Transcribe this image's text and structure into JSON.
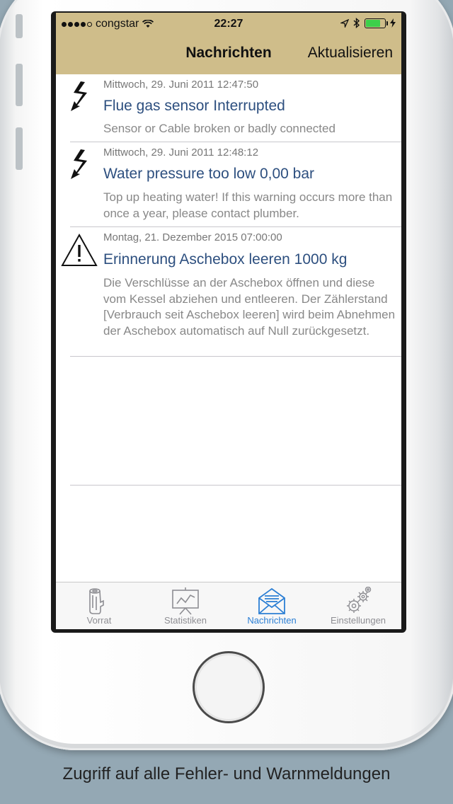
{
  "status_bar": {
    "carrier": "congstar",
    "time": "22:27"
  },
  "nav": {
    "title": "Nachrichten",
    "right_button": "Aktualisieren"
  },
  "messages": [
    {
      "icon": "lightning-icon",
      "date": "Mittwoch, 29. Juni 2011 12:47:50",
      "title": "Flue gas sensor Interrupted",
      "description": "Sensor or Cable broken or badly connected"
    },
    {
      "icon": "lightning-icon",
      "date": "Mittwoch, 29. Juni 2011 12:48:12",
      "title": "Water pressure too low 0,00 bar",
      "description": "Top up heating water! If this warning occurs more than once a year, please contact plumber."
    },
    {
      "icon": "warning-triangle-icon",
      "date": "Montag, 21. Dezember 2015 07:00:00",
      "title": "Erinnerung Aschebox leeren 1000 kg",
      "description": "Die Verschlüsse an der Aschebox öffnen und diese vom Kessel abziehen und entleeren. Der Zählerstand [Verbrauch seit Aschebox leeren] wird beim Abnehmen der Aschebox automatisch auf Null zurückgesetzt."
    }
  ],
  "tabs": [
    {
      "label": "Vorrat",
      "icon": "wood-log-icon",
      "active": false
    },
    {
      "label": "Statistiken",
      "icon": "chart-board-icon",
      "active": false
    },
    {
      "label": "Nachrichten",
      "icon": "envelope-icon",
      "active": true
    },
    {
      "label": "Einstellungen",
      "icon": "gears-icon",
      "active": false
    }
  ],
  "colors": {
    "navbar": "#cfbd8a",
    "title_blue": "#2d4f7f",
    "active_tab": "#2c7fd4",
    "background": "#94a8b4"
  },
  "caption": "Zugriff auf alle Fehler- und Warnmeldungen"
}
